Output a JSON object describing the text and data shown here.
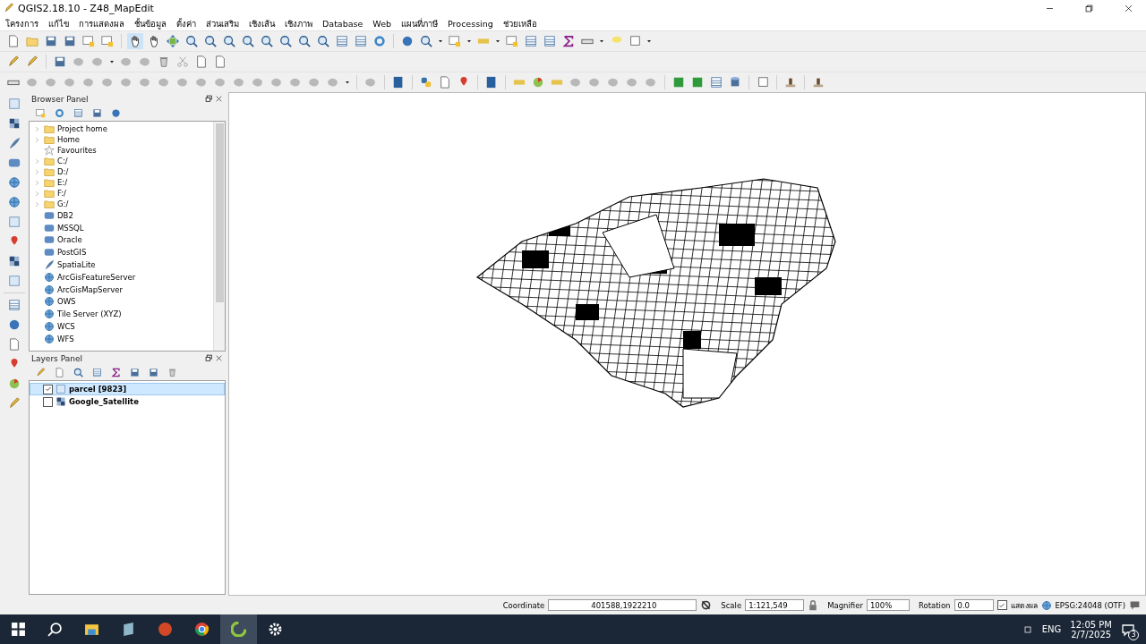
{
  "window": {
    "title": "QGIS2.18.10 - Z48_MapEdit"
  },
  "menu": [
    "โครงการ",
    "แก้ไข",
    "การแสดงผล",
    "ชั้นข้อมูล",
    "ตั้งค่า",
    "ส่วนเสริม",
    "เชิงเส้น",
    "เชิงภาพ",
    "Database",
    "Web",
    "แผนที่ภาษี",
    "Processing",
    "ช่วยเหลือ"
  ],
  "browser_panel": {
    "title": "Browser Panel",
    "items": [
      {
        "label": "Project home",
        "kind": "folder",
        "expandable": true
      },
      {
        "label": "Home",
        "kind": "folder",
        "expandable": true
      },
      {
        "label": "Favourites",
        "kind": "star",
        "expandable": false
      },
      {
        "label": "C:/",
        "kind": "folder",
        "expandable": true
      },
      {
        "label": "D:/",
        "kind": "folder",
        "expandable": true
      },
      {
        "label": "E:/",
        "kind": "folder",
        "expandable": true
      },
      {
        "label": "F:/",
        "kind": "folder",
        "expandable": true
      },
      {
        "label": "G:/",
        "kind": "folder",
        "expandable": true
      },
      {
        "label": "DB2",
        "kind": "database",
        "expandable": false
      },
      {
        "label": "MSSQL",
        "kind": "database",
        "expandable": false
      },
      {
        "label": "Oracle",
        "kind": "database",
        "expandable": false
      },
      {
        "label": "PostGIS",
        "kind": "database",
        "expandable": false
      },
      {
        "label": "SpatiaLite",
        "kind": "feather",
        "expandable": false
      },
      {
        "label": "ArcGisFeatureServer",
        "kind": "globe",
        "expandable": false
      },
      {
        "label": "ArcGisMapServer",
        "kind": "globe",
        "expandable": false
      },
      {
        "label": "OWS",
        "kind": "globe",
        "expandable": false
      },
      {
        "label": "Tile Server (XYZ)",
        "kind": "globe",
        "expandable": false
      },
      {
        "label": "WCS",
        "kind": "globe",
        "expandable": false
      },
      {
        "label": "WFS",
        "kind": "globe",
        "expandable": false
      }
    ]
  },
  "layers_panel": {
    "title": "Layers Panel",
    "layers": [
      {
        "name": "parcel [9823]",
        "kind": "vector",
        "checked": true,
        "selected": true
      },
      {
        "name": "Google_Satellite",
        "kind": "raster",
        "checked": false,
        "selected": false
      }
    ]
  },
  "status_bar": {
    "coordinate_label": "Coordinate",
    "coordinate_value": "401588,1922210",
    "scale_label": "Scale",
    "scale_value": "1:121,549",
    "magnifier_label": "Magnifier",
    "magnifier_value": "100%",
    "rotation_label": "Rotation",
    "rotation_value": "0.0",
    "render_label": "แสดงผล",
    "render_checked": true,
    "crs": "EPSG:24048 (OTF)"
  },
  "taskbar": {
    "language": "ENG",
    "time": "12:05 PM",
    "date": "2/7/2025",
    "notification_count": "3"
  }
}
